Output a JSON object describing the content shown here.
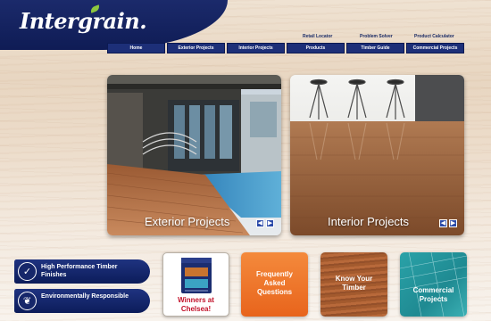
{
  "brand": {
    "name": "Intergrain."
  },
  "utility_links": [
    "Retail Locator",
    "Problem Solver",
    "Product Calculator"
  ],
  "nav": [
    "Home",
    "Exterior Projects",
    "Interior Projects",
    "Products",
    "Timber Guide",
    "Commercial Projects"
  ],
  "panels": {
    "exterior": {
      "label": "Exterior Projects"
    },
    "interior": {
      "label": "Interior Projects"
    }
  },
  "arrows": {
    "prev": "◀",
    "next": "▶"
  },
  "features": [
    {
      "label": "High Performance Timber Finishes",
      "icon": "check-icon"
    },
    {
      "label": "Environmentally Responsible",
      "icon": "leaf-icon"
    }
  ],
  "tiles": {
    "winners": {
      "label": "Winners at Chelsea!"
    },
    "faq": {
      "label": "Frequently Asked Questions"
    },
    "timber": {
      "label": "Know Your Timber"
    },
    "commercial": {
      "label": "Commercial Projects"
    }
  },
  "colors": {
    "navy": "#1d2f78",
    "orange": "#ee6a1f",
    "teal": "#2a9aa0",
    "brown": "#a35a2e",
    "red_text": "#c2122a"
  }
}
